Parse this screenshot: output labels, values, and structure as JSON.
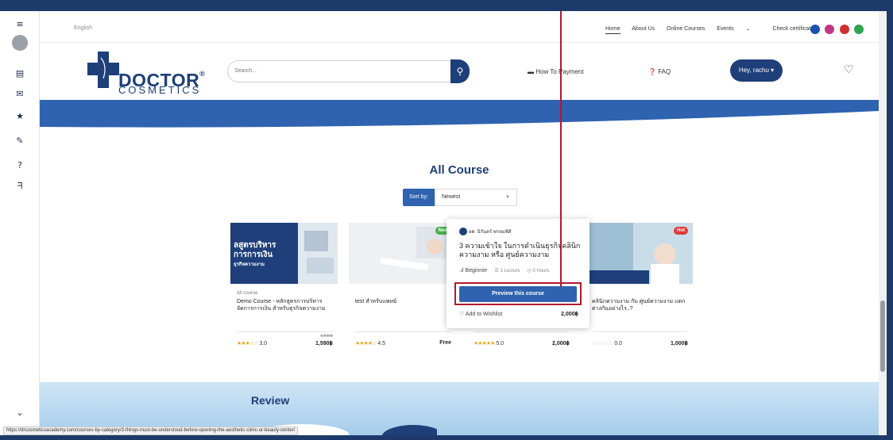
{
  "topbar": {
    "language": "English",
    "nav": [
      "Home",
      "About Us",
      "Online Courses",
      "Events",
      "Check certificate"
    ],
    "social_colors": [
      "#1c4fb0",
      "#c13584",
      "#d32f2f",
      "#2ea44f"
    ]
  },
  "logo": {
    "line1": "DOCTOR",
    "line2": "COSMETICS",
    "reg": "®"
  },
  "search": {
    "placeholder": "Search..."
  },
  "header": {
    "how_to_payment": "How To Payment",
    "faq": "FAQ",
    "user_button": "Hey, rachu"
  },
  "main": {
    "title": "All Course",
    "sort_label": "Sort by:",
    "sort_value": "Newest"
  },
  "courses": [
    {
      "image_text": [
        "ลสูตรบริหาร",
        "การการเงิน",
        "ธุรกิจความงาม"
      ],
      "category": "All course",
      "title": "Demo Course - หลักสูตรการบริหารจัดการการเงิน สำหรับธุรกิจความงาม",
      "rating": "3.0",
      "old_price": "1,590฿",
      "price": "1,590฿"
    },
    {
      "badge": "New",
      "category": "",
      "title": "test สำหรับแพทย์",
      "rating": "4.5",
      "price": "Free"
    },
    {
      "category": "",
      "title": "",
      "rating": "5.0",
      "price": "2,000฿"
    },
    {
      "badge": "Hot",
      "category": "",
      "title": "คลินิกความงาม กับ ศูนย์ความงาม แตกต่างกันอย่างไร..?",
      "rating": "0.0",
      "price": "1,000฿"
    }
  ],
  "popup": {
    "instructor": "ผศ. นิรันดร์ พรหมพิสิ",
    "title": "3 ความเข้าใจ ในการดำเนินธุรกิจคลินิกความงาม หรือ ศูนย์ความงาม",
    "level": "Beginner",
    "lecture": "1 Lecture",
    "hours": "0 Hours",
    "preview_button": "Preview this course",
    "wishlist": "Add to Wishlist",
    "price": "2,000฿"
  },
  "review": {
    "title": "Review"
  },
  "status_url": "https://drcosmeticsacademy.com/courses-by-category/3-things-must-be-understood-before-opening-the-aesthetic-clinic-or-beauty-center/",
  "colors": {
    "brand": "#1e3f7a",
    "accent": "#2f63b0",
    "highlight": "#b1182f",
    "star": "#e9a61c"
  }
}
